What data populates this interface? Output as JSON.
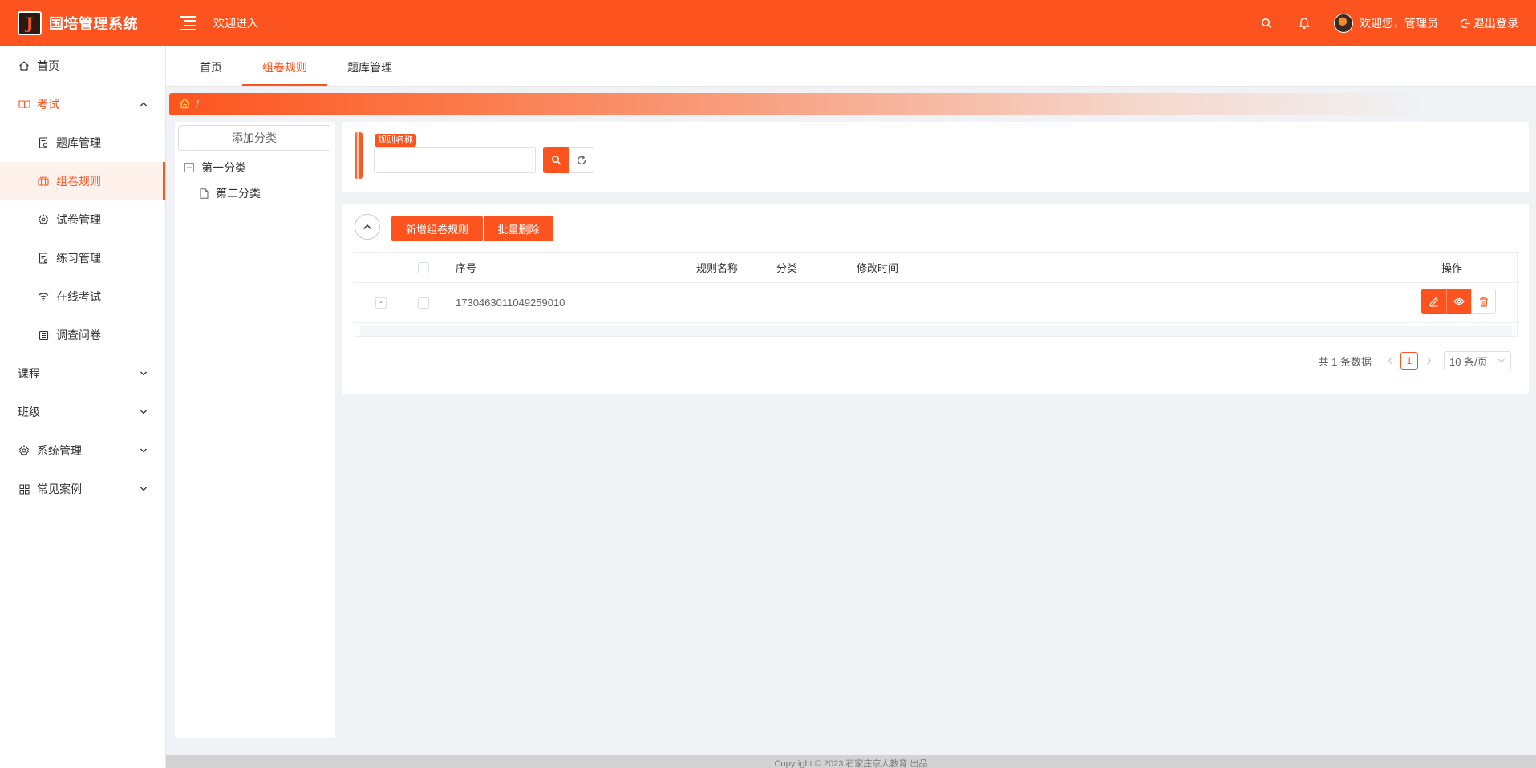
{
  "header": {
    "logo_letter": "J",
    "title": "国培管理系统",
    "welcome_text": "欢迎进入",
    "user_greeting": "欢迎您，管理员",
    "logout_label": "退出登录",
    "brand_color": "#fd541f"
  },
  "sidebar": {
    "items": [
      {
        "label": "首页",
        "icon": "home-icon"
      },
      {
        "label": "考试",
        "icon": "book-icon"
      },
      {
        "label": "题库管理",
        "icon": "document-icon"
      },
      {
        "label": "组卷规则",
        "icon": "paper-stack-icon"
      },
      {
        "label": "试卷管理",
        "icon": "gear-icon"
      },
      {
        "label": "练习管理",
        "icon": "practice-icon"
      },
      {
        "label": "在线考试",
        "icon": "wifi-icon"
      },
      {
        "label": "调查问卷",
        "icon": "survey-icon"
      },
      {
        "label": "课程"
      },
      {
        "label": "班级"
      },
      {
        "label": "系统管理",
        "icon": "gear-icon"
      },
      {
        "label": "常见案例",
        "icon": "grid-icon"
      }
    ]
  },
  "tabs": [
    {
      "label": "首页"
    },
    {
      "label": "组卷规则"
    },
    {
      "label": "题库管理"
    }
  ],
  "breadcrumb": {
    "separator": "/"
  },
  "tree": {
    "add_label": "添加分类",
    "nodes": [
      {
        "label": "第一分类"
      },
      {
        "label": "第二分类"
      }
    ]
  },
  "search": {
    "field_label": "规则名称",
    "value": "",
    "placeholder": ""
  },
  "toolbar": {
    "add_label": "新增组卷规则",
    "batch_delete_label": "批量删除"
  },
  "table": {
    "columns": [
      "序号",
      "规则名称",
      "分类",
      "修改时间",
      "操作"
    ],
    "rows": [
      {
        "expand": "-",
        "id": "1730463011049259010",
        "name": "",
        "category": "",
        "modified": ""
      }
    ]
  },
  "pagination": {
    "total_text": "共 1 条数据",
    "current_page": "1",
    "page_size": "10 条/页"
  },
  "footer": {
    "text": "Copyright © 2023 石家庄京人教育 出品"
  }
}
